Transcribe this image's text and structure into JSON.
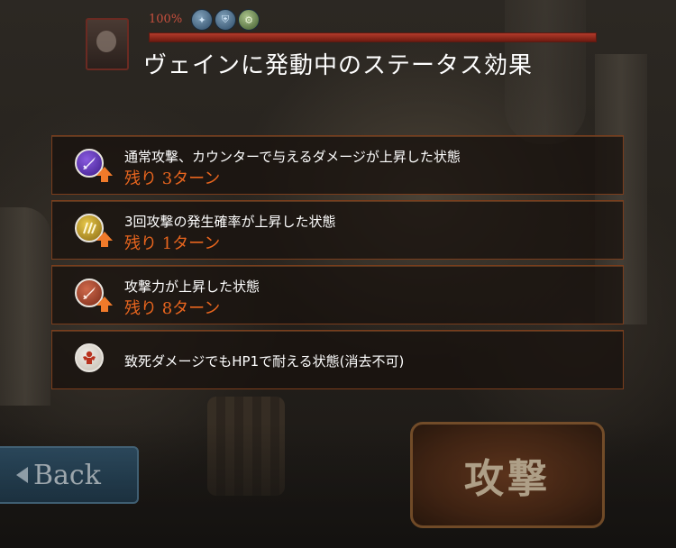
{
  "hud": {
    "hp_percent_text": "100%",
    "hp_fill_fraction": 1.0,
    "buff_icons": [
      {
        "name": "debuff-shield-icon",
        "glyph": "✦"
      },
      {
        "name": "debuff-shield-icon",
        "glyph": "⛨"
      },
      {
        "name": "gear-icon",
        "glyph": "⚙"
      }
    ]
  },
  "title": "ヴェインに発動中のステータス効果",
  "status_effects": [
    {
      "icon": "sword-up-icon",
      "color": "#5a2fc0",
      "description": "通常攻撃、カウンターで与えるダメージが上昇した状態",
      "turns": "残り 3ターン"
    },
    {
      "icon": "multi-attack-up-icon",
      "color": "#c8a020",
      "description": "3回攻撃の発生確率が上昇した状態",
      "turns": "残り 1ターン"
    },
    {
      "icon": "attack-up-icon",
      "color": "#b24a2e",
      "description": "攻撃力が上昇した状態",
      "turns": "残り 8ターン"
    },
    {
      "icon": "guts-icon",
      "color": "#e8e4de",
      "description": "致死ダメージでもHP1で耐える状態(消去不可)",
      "turns": ""
    }
  ],
  "buttons": {
    "back": "Back",
    "attack": "攻撃"
  },
  "colors": {
    "accent_turns": "#e8651e",
    "row_border": "#7a3d1c"
  }
}
